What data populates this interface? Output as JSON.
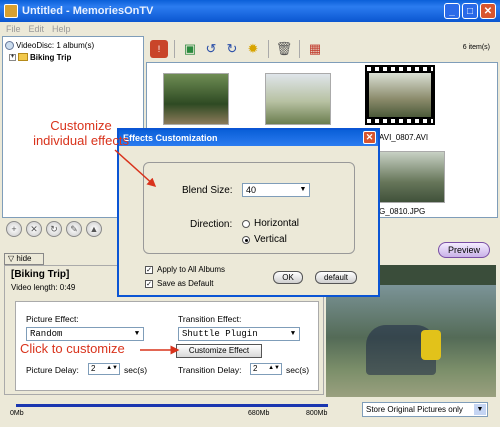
{
  "window": {
    "title": "Untitled - MemoriesOnTV"
  },
  "menu": [
    "File",
    "Edit",
    "Help"
  ],
  "tree": {
    "root": "VideoDisc: 1 album(s)",
    "album": "Biking Trip"
  },
  "photos": {
    "count_label": "6 item(s)",
    "captions": [
      "AVI_0807.AVI",
      "G_0810.JPG"
    ]
  },
  "tabs": {
    "hide": "hide"
  },
  "buttons": {
    "preview": "Preview",
    "customize_effect": "Customize Effect"
  },
  "album_panel": {
    "title": "[Biking Trip]",
    "video_length": "Video length:  0:49",
    "picture_effect_label": "Picture Effect:",
    "picture_effect_value": "Random",
    "transition_effect_label": "Transition Effect:",
    "transition_effect_value": "Shuttle Plugin",
    "picture_delay_label": "Picture Delay:",
    "picture_delay_value": "2",
    "transition_delay_label": "Transition Delay:",
    "transition_delay_value": "2",
    "unit": "sec(s)"
  },
  "timeline": {
    "labels": [
      "0Mb",
      "680Mb",
      "800Mb"
    ],
    "store_option": "Store Original Pictures only"
  },
  "dialog": {
    "title": "Effects Customization",
    "blend_size_label": "Blend Size:",
    "blend_size_value": "40",
    "direction_label": "Direction:",
    "direction_options": [
      "Horizontal",
      "Vertical"
    ],
    "direction_selected": "Vertical",
    "apply_all_label": "Apply to All Albums",
    "save_default_label": "Save as Default",
    "ok_label": "OK",
    "default_label": "default"
  },
  "annotations": {
    "customize_individual_line1": "Customize",
    "customize_individual_line2": "individual effects",
    "click_to_customize": "Click to customize"
  },
  "colors": {
    "annotation": "#d9331c",
    "titlebar": "#0a5fd8",
    "track": "#1b37b0"
  }
}
